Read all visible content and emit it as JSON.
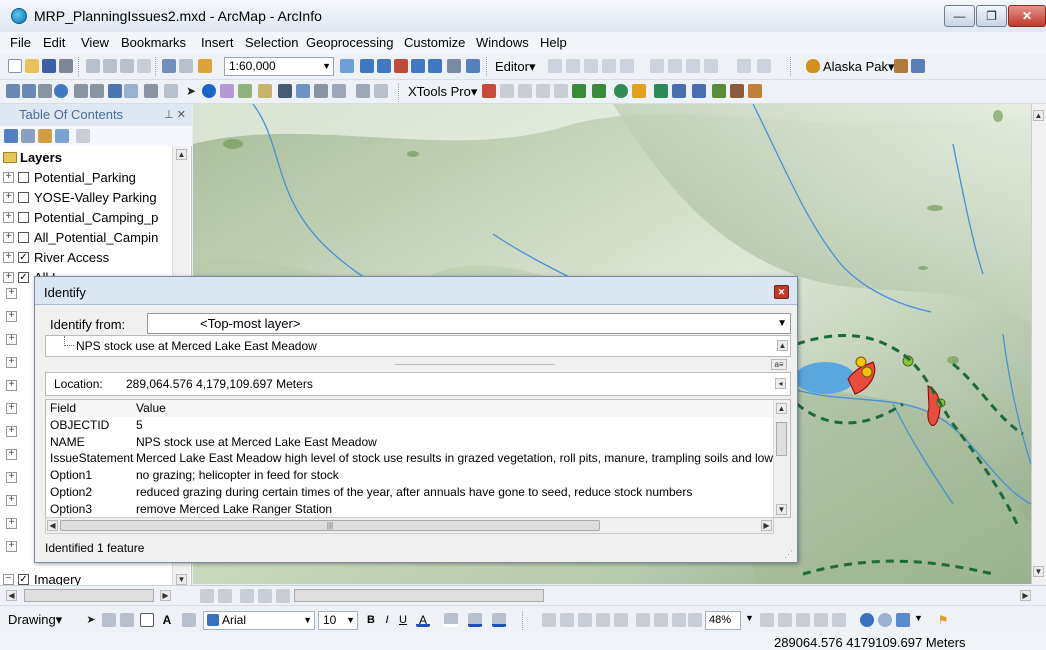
{
  "window": {
    "title": "MRP_PlanningIssues2.mxd - ArcMap - ArcInfo",
    "min_label": "—",
    "max_label": "❐",
    "close_label": "✕"
  },
  "menu": [
    "File",
    "Edit",
    "View",
    "Bookmarks",
    "Insert",
    "Selection",
    "Geoprocessing",
    "Customize",
    "Windows",
    "Help"
  ],
  "toolbar": {
    "scale": "1:60,000",
    "editor_label": "Editor▾",
    "alaska_label": "Alaska Pak▾",
    "xtools_label": "XTools Pro▾"
  },
  "toc": {
    "title": "Table Of Contents",
    "root": "Layers",
    "layers": [
      {
        "name": "Potential_Parking",
        "checked": false
      },
      {
        "name": "YOSE-Valley Parking",
        "checked": false
      },
      {
        "name": "Potential_Camping_p",
        "checked": false
      },
      {
        "name": "All_Potential_Campin",
        "checked": false
      },
      {
        "name": "River Access",
        "checked": true
      },
      {
        "name": "All I",
        "checked": true
      }
    ],
    "bottom_layer": "Imagery"
  },
  "identify": {
    "title": "Identify",
    "from_label": "Identify from:",
    "from_value": "<Top-most layer>",
    "feature": "NPS stock use at Merced Lake East Meadow",
    "location_label": "Location:",
    "location_value": "289,064.576  4,179,109.697 Meters",
    "header_field": "Field",
    "header_value": "Value",
    "rows": [
      {
        "field": "OBJECTID",
        "value": "5"
      },
      {
        "field": "NAME",
        "value": "NPS stock use at Merced Lake East Meadow"
      },
      {
        "field": "IssueStatement",
        "value": "Merced Lake East Meadow high level of stock use results in grazed vegetation, roll pits, manure, trampling soils and low plan"
      },
      {
        "field": "Option1",
        "value": "no grazing; helicopter in feed for stock"
      },
      {
        "field": "Option2",
        "value": "reduced grazing during certain times of the year, after annuals have gone to seed, reduce stock numbers"
      },
      {
        "field": "Option3",
        "value": "remove Merced Lake Ranger Station"
      }
    ],
    "status": "Identified 1 feature"
  },
  "drawing": {
    "label": "Drawing▾",
    "font": "Arial",
    "font_size": "10",
    "zoom": "48%"
  },
  "status": {
    "coords": "289064.576  4179109.697 Meters"
  },
  "colors": {
    "title_bar": "#dfe7f2",
    "close_red": "#c0392b",
    "map_terrain": "#c9d8bd",
    "lake": "#5aa7e0",
    "boundary": "#1c6b3a",
    "river": "#4a90d9"
  }
}
